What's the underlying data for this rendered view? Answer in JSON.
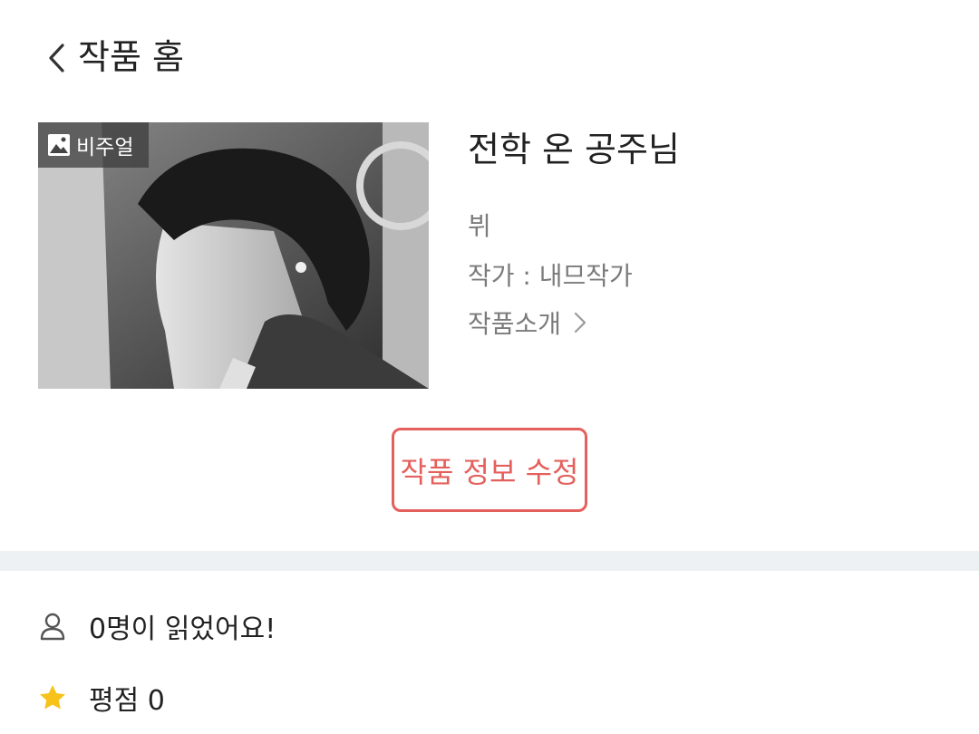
{
  "header": {
    "title": "작품 홈"
  },
  "cover": {
    "badge_label": "비주얼",
    "badge_icon": "image-icon"
  },
  "work": {
    "title": "전학 온 공주님",
    "character": "뷔",
    "author_line": "작가 : 내므작가",
    "intro_label": "작품소개"
  },
  "actions": {
    "edit_label": "작품 정보 수정",
    "edit_color": "#e4605c"
  },
  "stats": {
    "readers_label": "0명이 읽었어요!",
    "rating_label": "평점 0",
    "star_color": "#f7c31a"
  }
}
